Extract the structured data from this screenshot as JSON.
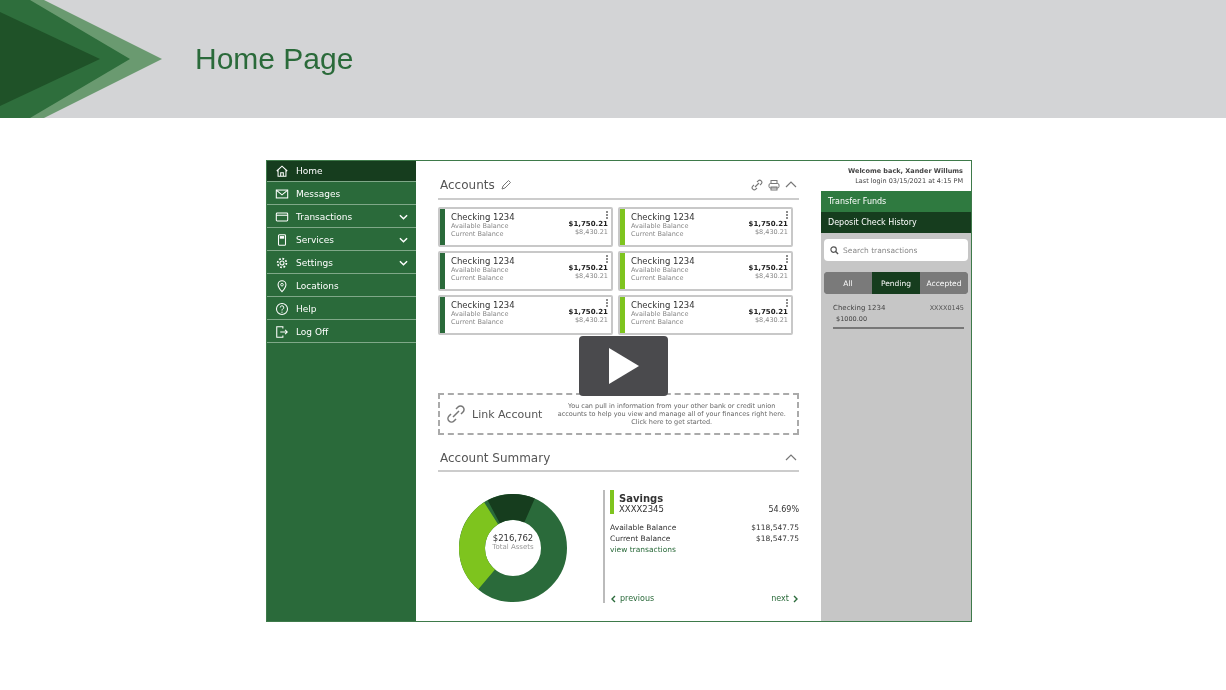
{
  "slide": {
    "title": "Home Page"
  },
  "sidebar": {
    "items": [
      {
        "label": "Home",
        "selected": true,
        "has_submenu": false
      },
      {
        "label": "Messages",
        "selected": false,
        "has_submenu": false
      },
      {
        "label": "Transactions",
        "selected": false,
        "has_submenu": true
      },
      {
        "label": "Services",
        "selected": false,
        "has_submenu": true
      },
      {
        "label": "Settings",
        "selected": false,
        "has_submenu": true
      },
      {
        "label": "Locations",
        "selected": false,
        "has_submenu": false
      },
      {
        "label": "Help",
        "selected": false,
        "has_submenu": false
      },
      {
        "label": "Log Off",
        "selected": false,
        "has_submenu": false
      }
    ]
  },
  "accounts": {
    "title": "Accounts",
    "cards": [
      {
        "name": "Checking 1234",
        "available_label": "Available Balance",
        "current_label": "Current Balance",
        "available": "$1,750.21",
        "current": "$8,430.21",
        "color": "#2a6a3a"
      },
      {
        "name": "Checking 1234",
        "available_label": "Available Balance",
        "current_label": "Current Balance",
        "available": "$1,750.21",
        "current": "$8,430.21",
        "color": "#7ec41e"
      },
      {
        "name": "Checking 1234",
        "available_label": "Available Balance",
        "current_label": "Current Balance",
        "available": "$1,750.21",
        "current": "$8,430.21",
        "color": "#2a6a3a"
      },
      {
        "name": "Checking 1234",
        "available_label": "Available Balance",
        "current_label": "Current Balance",
        "available": "$1,750.21",
        "current": "$8,430.21",
        "color": "#7ec41e"
      },
      {
        "name": "Checking 1234",
        "available_label": "Available Balance",
        "current_label": "Current Balance",
        "available": "$1,750.21",
        "current": "$8,430.21",
        "color": "#2a6a3a"
      },
      {
        "name": "Checking 1234",
        "available_label": "Available Balance",
        "current_label": "Current Balance",
        "available": "$1,750.21",
        "current": "$8,430.21",
        "color": "#7ec41e"
      }
    ]
  },
  "link_account": {
    "label": "Link Account",
    "description": "You can pull in information from your other bank or credit union accounts to help you view and manage all of your finances right here. Click here to get started."
  },
  "summary": {
    "title": "Account Summary",
    "total": "$216,762",
    "total_label": "Total Assets",
    "account": {
      "name": "Savings",
      "number": "XXXX2345",
      "percent": "54.69%",
      "color": "#7ec41e",
      "rows": [
        {
          "label": "Available Balance",
          "value": "$118,547.75"
        },
        {
          "label": "Current Balance",
          "value": "$18,547.75"
        }
      ],
      "link": "view transactions",
      "previous": "previous",
      "next": "next"
    }
  },
  "panel": {
    "welcome": "Welcome back, Xander Willums",
    "last_login": "Last login 03/15/2021 at 4:15 PM",
    "actions": [
      {
        "label": "Transfer Funds",
        "selected": false
      },
      {
        "label": "Deposit Check History",
        "selected": true
      }
    ],
    "search": {
      "placeholder": "Search transactions"
    },
    "filters": [
      {
        "label": "All",
        "selected": false
      },
      {
        "label": "Pending",
        "selected": true
      },
      {
        "label": "Accepted",
        "selected": false
      }
    ],
    "transactions": [
      {
        "name": "Checking 1234",
        "number": "XXXX0145",
        "amount": "$1000.00"
      }
    ]
  }
}
